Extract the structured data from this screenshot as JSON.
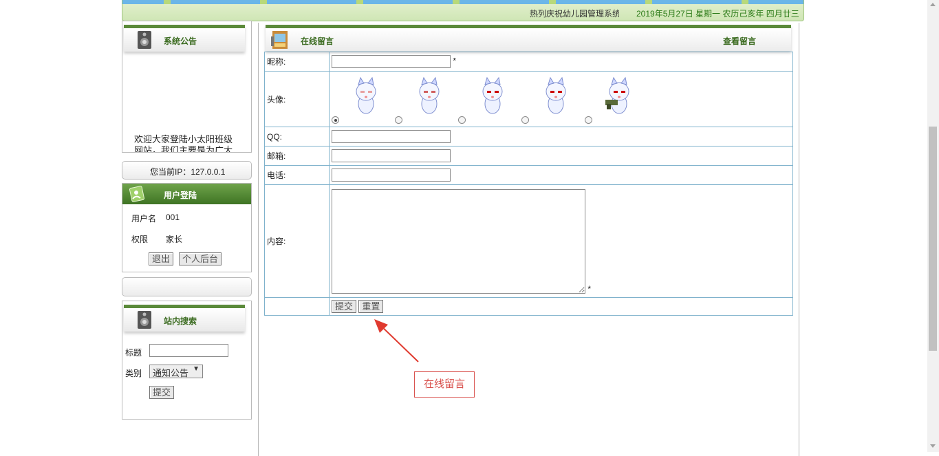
{
  "banner": {
    "marquee_text": "热列庆祝幼儿园管理系统",
    "date_text": "2019年5月27日 星期一 农历己亥年 四月廿三"
  },
  "announcement": {
    "title": "系统公告",
    "body": "欢迎大家登陆小太阳班级网站，我们主要是为广大朋友"
  },
  "ip": {
    "text": "您当前IP：127.0.0.1"
  },
  "login": {
    "title": "用户登陆",
    "username_label": "用户名",
    "username_value": "001",
    "role_label": "权限",
    "role_value": "家长",
    "logout_button": "退出",
    "backend_button": "个人后台"
  },
  "search": {
    "title": "站内搜索",
    "title_label": "标题",
    "title_value": "",
    "category_label": "类别",
    "category_value": "通知公告",
    "submit_button": "提交"
  },
  "main": {
    "title": "在线留言",
    "view_link": "查看留言",
    "form": {
      "nickname_label": "昵称:",
      "avatar_label": "头像:",
      "qq_label": "QQ:",
      "email_label": "邮箱:",
      "phone_label": "电话:",
      "content_label": "内容:",
      "required_mark": "*",
      "submit_button": "提交",
      "reset_button": "重置",
      "avatar_count": 5,
      "avatar_selected": 1
    }
  },
  "annotation": {
    "text": "在线留言",
    "color": "#e03a2f"
  },
  "colors": {
    "brand_green": "#5b8a3a",
    "table_border": "#7fb2cc"
  }
}
